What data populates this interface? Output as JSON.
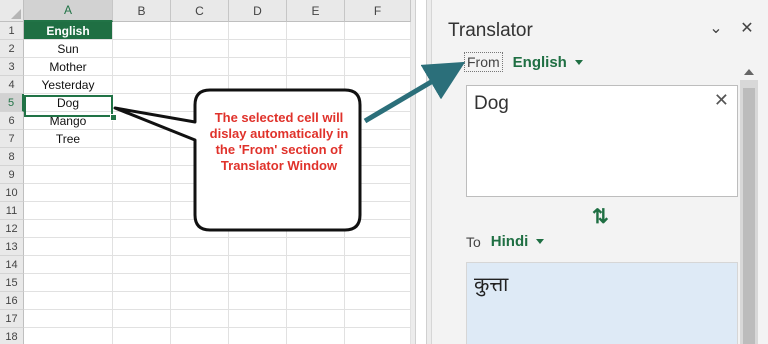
{
  "sheet": {
    "columns": [
      "A",
      "B",
      "C",
      "D",
      "E",
      "F"
    ],
    "rows": [
      "1",
      "2",
      "3",
      "4",
      "5",
      "6",
      "7",
      "8",
      "9",
      "10",
      "11",
      "12",
      "13",
      "14",
      "15",
      "16",
      "17",
      "18"
    ],
    "column_a_values": [
      "English",
      "Sun",
      "Mother",
      "Yesterday",
      "Dog",
      "Mango",
      "Tree"
    ],
    "active_cell": "A5"
  },
  "callout": {
    "text": "The selected cell will dislay automatically in the 'From' section of Translator Window"
  },
  "translator": {
    "title": "Translator",
    "from_label": "From",
    "from_language": "English",
    "source_text": "Dog",
    "to_label": "To",
    "to_language": "Hindi",
    "translated_text": "कुत्ता",
    "swap_glyph": "⇅",
    "clear_glyph": "✕",
    "close_glyph": "✕",
    "options_glyph": "⌄"
  },
  "colors": {
    "accent": "#1f6f43",
    "callout_text": "#e0322b",
    "arrow": "#2b6f7a",
    "target_bg": "#deeaf6"
  }
}
